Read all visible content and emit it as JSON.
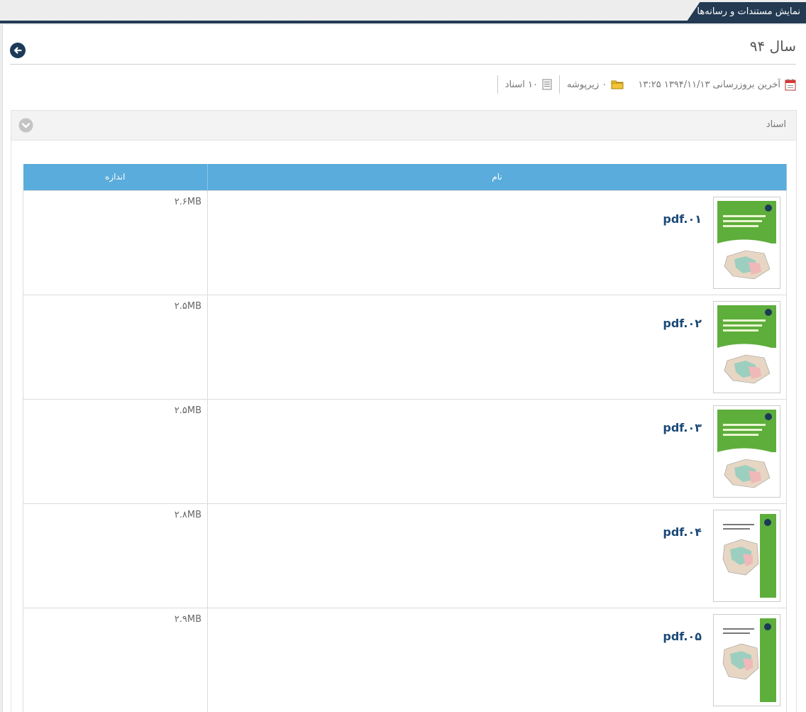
{
  "top_tab": {
    "label": "نمایش مستندات و رسانه‌ها"
  },
  "page": {
    "title": "سال ۹۴"
  },
  "meta": {
    "last_update": "آخرین بروزرسانی ۱۳۹۴/۱۱/۱۳ ۱۳:۲۵",
    "subfolders": "۰ زیرپوشه",
    "documents": "۱۰ اسناد"
  },
  "panel": {
    "title": "اسناد"
  },
  "table": {
    "headers": {
      "name": "نام",
      "size": "اندازه"
    },
    "rows": [
      {
        "name": "pdf.۰۱",
        "size": "۲.۶MB",
        "thumb": "green-cover-map"
      },
      {
        "name": "pdf.۰۲",
        "size": "۲.۵MB",
        "thumb": "green-cover-map"
      },
      {
        "name": "pdf.۰۳",
        "size": "۲.۵MB",
        "thumb": "green-cover-map"
      },
      {
        "name": "pdf.۰۴",
        "size": "۲.۸MB",
        "thumb": "side-stripe-map"
      },
      {
        "name": "pdf.۰۵",
        "size": "۲.۹MB",
        "thumb": "side-stripe-map"
      }
    ]
  },
  "colors": {
    "nav_dark": "#233a52",
    "table_header": "#59acdb",
    "link": "#1b4a78",
    "cover_green": "#5eae3c"
  },
  "icons": {
    "back": "arrow-left-circle-icon",
    "calendar": "calendar-icon",
    "folder": "folder-icon",
    "document": "document-icon",
    "collapse": "chevron-down-circle-icon"
  }
}
